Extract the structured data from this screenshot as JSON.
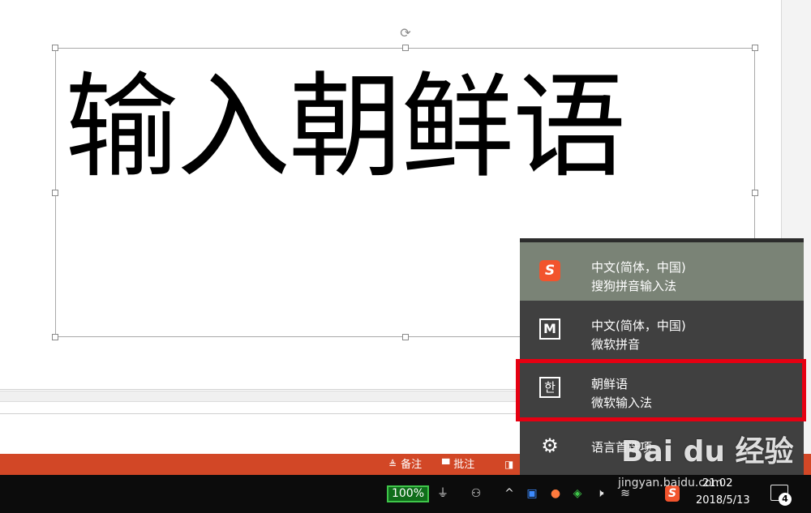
{
  "slide": {
    "text": "输入朝鲜语"
  },
  "statusbar": {
    "notes_label": "备注",
    "comments_label": "批注"
  },
  "language_menu": {
    "items": [
      {
        "icon": "S",
        "icon_name": "sogou-icon",
        "line1": "中文(简体，中国)",
        "line2": "搜狗拼音输入法",
        "active": true
      },
      {
        "icon": "M",
        "icon_name": "microsoft-ime-icon",
        "line1": "中文(简体，中国)",
        "line2": "微软拼音",
        "active": false
      },
      {
        "icon": "한",
        "icon_name": "hangul-icon",
        "line1": "朝鲜语",
        "line2": "微软输入法",
        "active": false
      }
    ],
    "preferences_label": "语言首选项",
    "highlight_color": "#e60012"
  },
  "taskbar": {
    "battery": "100%",
    "time": "21:02",
    "date": "2018/5/13",
    "notification_count": "4"
  },
  "watermark": {
    "logo": "Bai du 经验",
    "url": "jingyan.baidu.com"
  },
  "colors": {
    "statusbar": "#d24726",
    "flyout_bg": "#404040",
    "flyout_active": "#7a8376",
    "taskbar": "#0c0c0c"
  }
}
